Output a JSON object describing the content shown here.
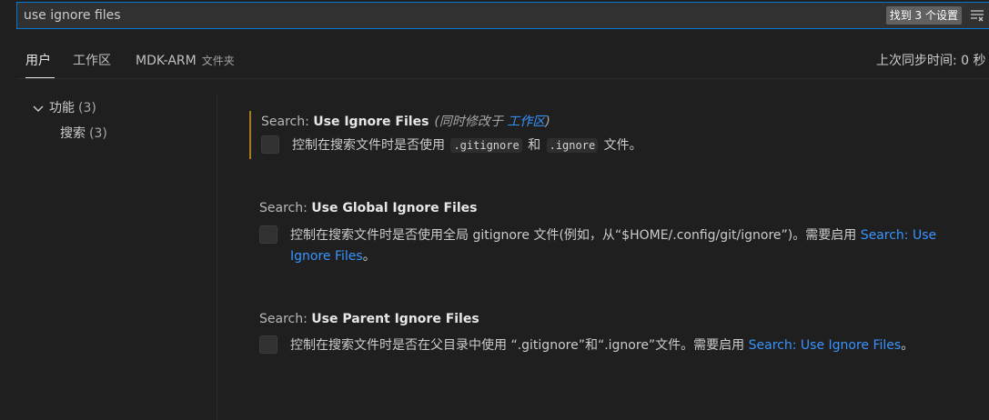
{
  "search": {
    "value": "use ignore files",
    "result_count": "找到 3 个设置",
    "filter_icon": "filter-list-icon"
  },
  "tabs": [
    {
      "label": "用户"
    },
    {
      "label": "工作区"
    },
    {
      "label": "MDK-ARM",
      "sub": "文件夹"
    }
  ],
  "sync_status": "上次同步时间: 0 秒",
  "toc": {
    "group_label": "功能",
    "group_count": "(3)",
    "child_label": "搜索",
    "child_count": "(3)"
  },
  "settings": [
    {
      "category": "Search: ",
      "name": "Use Ignore Files",
      "modified_prefix": "(同时修改于 ",
      "modified_link": "工作区",
      "modified_suffix": ")",
      "desc_1": "控制在搜索文件时是否使用 ",
      "code_1": ".gitignore",
      "desc_2": " 和 ",
      "code_2": ".ignore",
      "desc_3": " 文件。"
    },
    {
      "category": "Search: ",
      "name": "Use Global Ignore Files",
      "desc_1": "控制在搜索文件时是否使用全局 gitignore 文件(例如，从“$HOME/.config/git/ignore”)。需要启用 ",
      "link_1": "Search: Use",
      "link_2": "Ignore Files",
      "desc_2": "。"
    },
    {
      "category": "Search: ",
      "name": "Use Parent Ignore Files",
      "desc_1": "控制在搜索文件时是否在父目录中使用 “.gitignore”和“.ignore”文件。需要启用 ",
      "link_1": "Search: Use Ignore Files",
      "desc_2": "。"
    }
  ]
}
